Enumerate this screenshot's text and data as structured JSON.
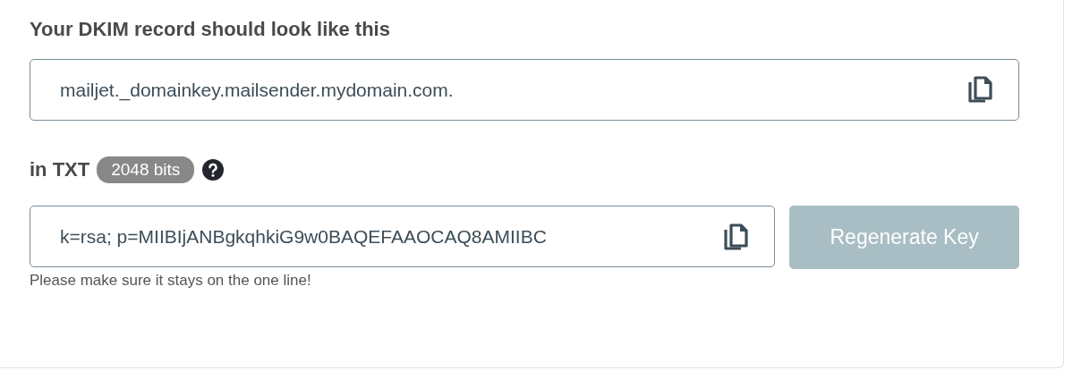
{
  "title": "Your DKIM record should look like this",
  "host_field": {
    "value": "mailjet._domainkey.mailsender.mydomain.com."
  },
  "record_type": {
    "label": "in TXT",
    "badge": "2048 bits"
  },
  "key_field": {
    "value": "k=rsa; p=MIIBIjANBgkqhkiG9w0BAQEFAAOCAQ8AMIIBC"
  },
  "regenerate_button": {
    "label": "Regenerate Key",
    "disabled": true
  },
  "help_text": "Please make sure it stays on the one line!"
}
